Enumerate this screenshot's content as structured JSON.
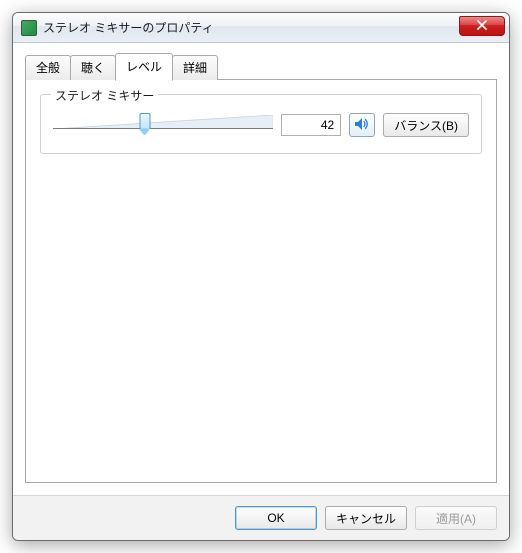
{
  "window": {
    "title": "ステレオ ミキサーのプロパティ"
  },
  "tabs": [
    {
      "label": "全般",
      "active": false
    },
    {
      "label": "聴く",
      "active": false
    },
    {
      "label": "レベル",
      "active": true
    },
    {
      "label": "詳細",
      "active": false
    }
  ],
  "level": {
    "group_label": "ステレオ ミキサー",
    "value": 42,
    "slider_min": 0,
    "slider_max": 100,
    "mute_icon": "speaker-icon",
    "balance_label": "バランス(B)"
  },
  "footer": {
    "ok": "OK",
    "cancel": "キャンセル",
    "apply": "適用(A)",
    "apply_enabled": false
  }
}
